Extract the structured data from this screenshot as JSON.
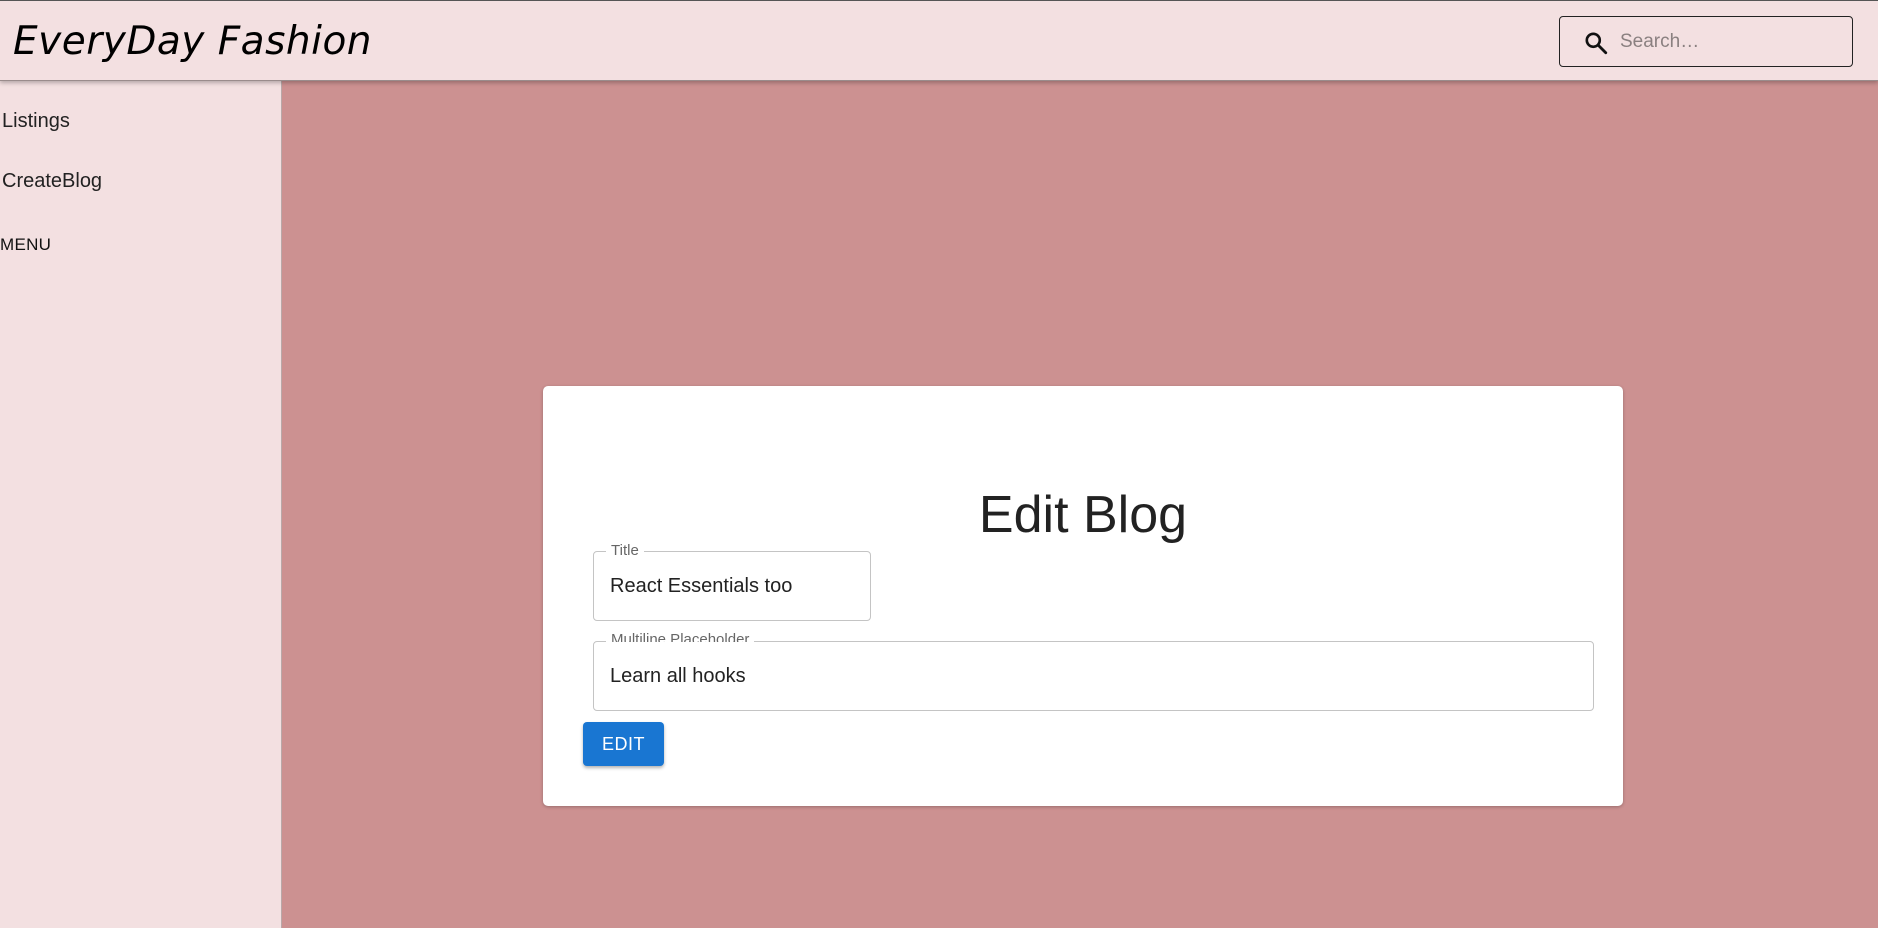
{
  "header": {
    "brand": "EveryDay Fashion",
    "search_placeholder": "Search…"
  },
  "sidebar": {
    "items": [
      {
        "label": "Listings"
      },
      {
        "label": "CreateBlog"
      }
    ],
    "menu_label": "MENU"
  },
  "form": {
    "title": "Edit Blog",
    "title_field": {
      "label": "Title",
      "value": "React Essentials too"
    },
    "body_field": {
      "label": "Multiline Placeholder",
      "value": "Learn all hooks"
    },
    "submit_label": "EDIT"
  },
  "colors": {
    "background": "#cc9191",
    "surface": "#f3e0e1",
    "primary_button": "#1976d2"
  }
}
